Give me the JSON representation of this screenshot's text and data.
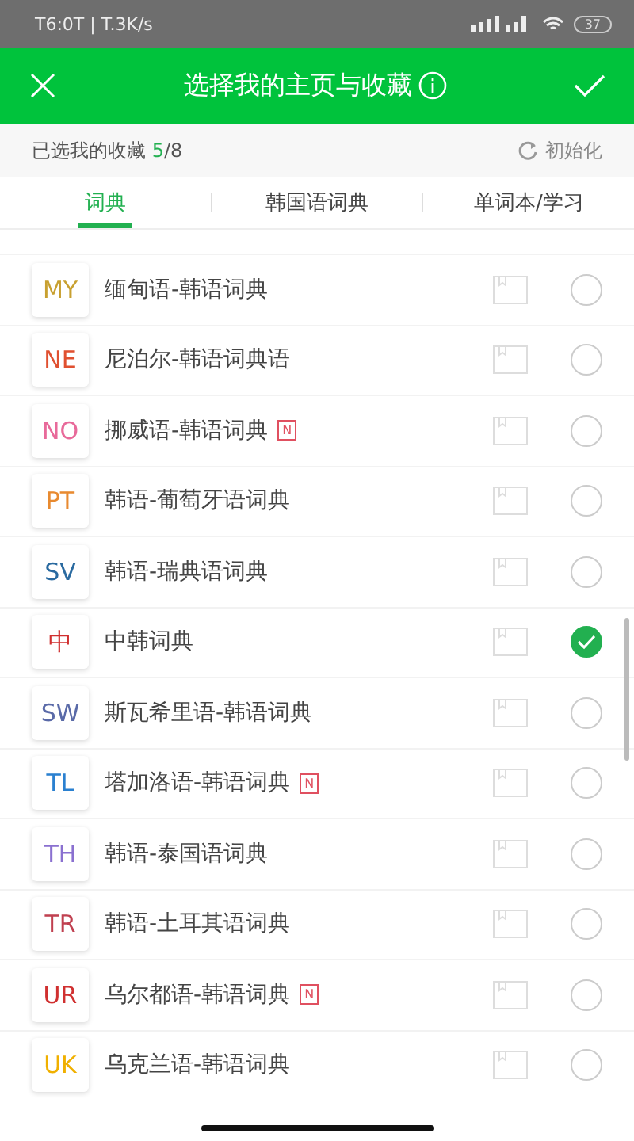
{
  "status_bar": {
    "time_speed": "T6:0T | T.3K/s",
    "battery": "37"
  },
  "header": {
    "title": "选择我的主页与收藏"
  },
  "summary": {
    "label": "已选我的收藏",
    "selected_count": "5",
    "separator": "/",
    "total": "8",
    "reset": "初始化"
  },
  "tabs": [
    {
      "label": "词典",
      "selected": true
    },
    {
      "label": "韩国语词典",
      "selected": false
    },
    {
      "label": "单词本/学习",
      "selected": false
    }
  ],
  "items": [
    {
      "code": "MY",
      "color": "#c8a030",
      "name": "缅甸语-韩语词典",
      "selected": false
    },
    {
      "code": "NE",
      "color": "#e05030",
      "name": "尼泊尔-韩语词典语",
      "selected": false
    },
    {
      "code": "NO",
      "color": "#e86a9a",
      "name": "挪威语-韩语词典",
      "badge": "N",
      "selected": false
    },
    {
      "code": "PT",
      "color": "#e88a30",
      "name": "韩语-葡萄牙语词典",
      "selected": false
    },
    {
      "code": "SV",
      "color": "#2a6aa0",
      "name": "韩语-瑞典语词典",
      "selected": false
    },
    {
      "code": "中",
      "color": "#d03030",
      "name": "中韩词典",
      "selected": true
    },
    {
      "code": "SW",
      "color": "#5a6aa8",
      "name": "斯瓦希里语-韩语词典",
      "selected": false
    },
    {
      "code": "TL",
      "color": "#2a80d0",
      "name": "塔加洛语-韩语词典",
      "badge": "N",
      "selected": false
    },
    {
      "code": "TH",
      "color": "#8a70d0",
      "name": "韩语-泰国语词典",
      "selected": false
    },
    {
      "code": "TR",
      "color": "#c04050",
      "name": "韩语-土耳其语词典",
      "selected": false
    },
    {
      "code": "UR",
      "color": "#d03030",
      "name": "乌尔都语-韩语词典",
      "badge": "N",
      "selected": false
    },
    {
      "code": "UK",
      "color": "#f0b000",
      "name": "乌克兰语-韩语词典",
      "selected": false
    }
  ]
}
